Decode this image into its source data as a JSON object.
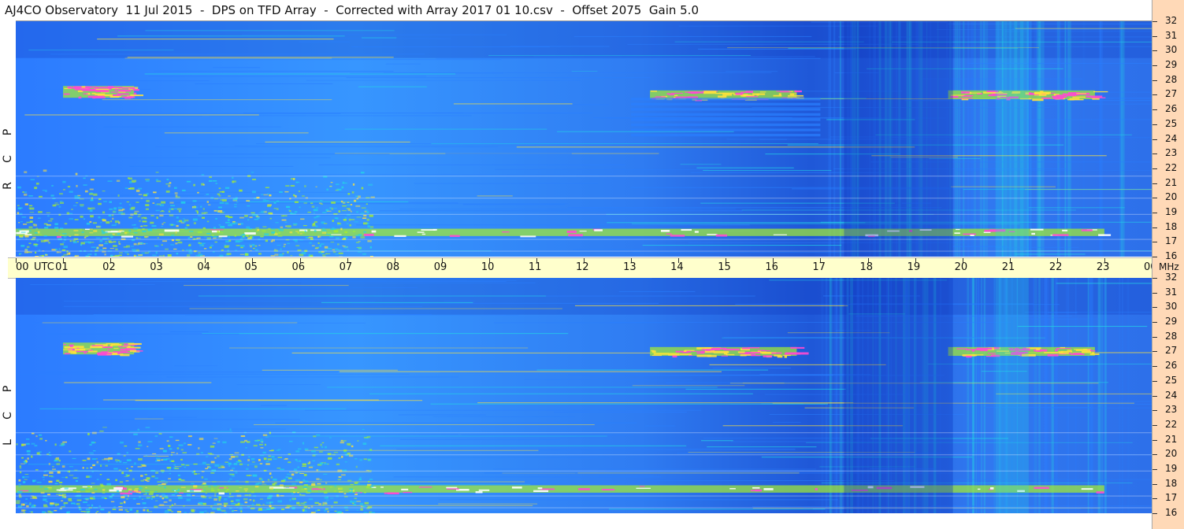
{
  "title": "AJ4CO Observatory  11 Jul 2015  -  DPS on TFD Array  -  Corrected with Array 2017 01 10.csv  -  Offset 2075  Gain 5.0",
  "panels": [
    {
      "name": "rcp",
      "letters": [
        "P",
        "C",
        "R"
      ]
    },
    {
      "name": "lcp",
      "letters": [
        "P",
        "C",
        "L"
      ]
    }
  ],
  "chart_data": {
    "type": "heatmap",
    "title": "AJ4CO Observatory  11 Jul 2015  -  DPS on TFD Array  -  Corrected with Array 2017 01 10.csv  -  Offset 2075  Gain 5.0",
    "x_axis": {
      "unit_label": "UTC",
      "ticks": [
        "00",
        "01",
        "02",
        "03",
        "04",
        "05",
        "06",
        "07",
        "08",
        "09",
        "10",
        "11",
        "12",
        "13",
        "14",
        "15",
        "16",
        "17",
        "18",
        "19",
        "20",
        "21",
        "22",
        "23",
        "00"
      ],
      "range_hours": [
        0,
        24
      ]
    },
    "y_axis": {
      "unit_label": "MHz",
      "range": [
        16,
        32
      ],
      "ticks": [
        32,
        31,
        30,
        29,
        28,
        27,
        26,
        25,
        24,
        23,
        22,
        21,
        20,
        19,
        18,
        17,
        16
      ]
    },
    "series": [
      {
        "name": "R C P"
      },
      {
        "name": "L C P"
      }
    ],
    "colors": {
      "low": "#0b2fb8",
      "mid_low": "#2a7fff",
      "mid": "#24d3e6",
      "mid_high": "#a6ee2e",
      "high": "#ffe23a",
      "very_high": "#ff4ad1",
      "max": "#ffffff",
      "axis_bg": "#ffffcc",
      "side_strip": "#ffd9b7"
    },
    "features": [
      {
        "panel": "both",
        "band_mhz": [
          26.8,
          27.6
        ],
        "time_utc": [
          1.0,
          2.5
        ],
        "level": "very_high"
      },
      {
        "panel": "both",
        "band_mhz": [
          26.7,
          27.3
        ],
        "time_utc": [
          13.4,
          16.5
        ],
        "level": "high"
      },
      {
        "panel": "both",
        "band_mhz": [
          26.7,
          27.3
        ],
        "time_utc": [
          19.7,
          22.8
        ],
        "level": "very_high"
      },
      {
        "panel": "both",
        "band_mhz": [
          17.4,
          17.9
        ],
        "time_utc": [
          0.0,
          23.0
        ],
        "level": "max"
      },
      {
        "panel": "both",
        "band_mhz": [
          16.0,
          22.0
        ],
        "time_utc": [
          0.0,
          7.5
        ],
        "level": "high"
      },
      {
        "panel": "rcp",
        "band_mhz": [
          24.0,
          26.8
        ],
        "time_utc": [
          13.0,
          17.0
        ],
        "level": "low",
        "pattern": "striped"
      },
      {
        "panel": "both",
        "band_mhz": [
          16.0,
          32.0
        ],
        "time_utc": [
          17.5,
          19.8
        ],
        "level": "low"
      },
      {
        "panel": "both",
        "band_mhz": [
          16.0,
          32.0
        ],
        "time_utc": [
          20.7,
          21.4
        ],
        "level": "mid"
      }
    ]
  }
}
